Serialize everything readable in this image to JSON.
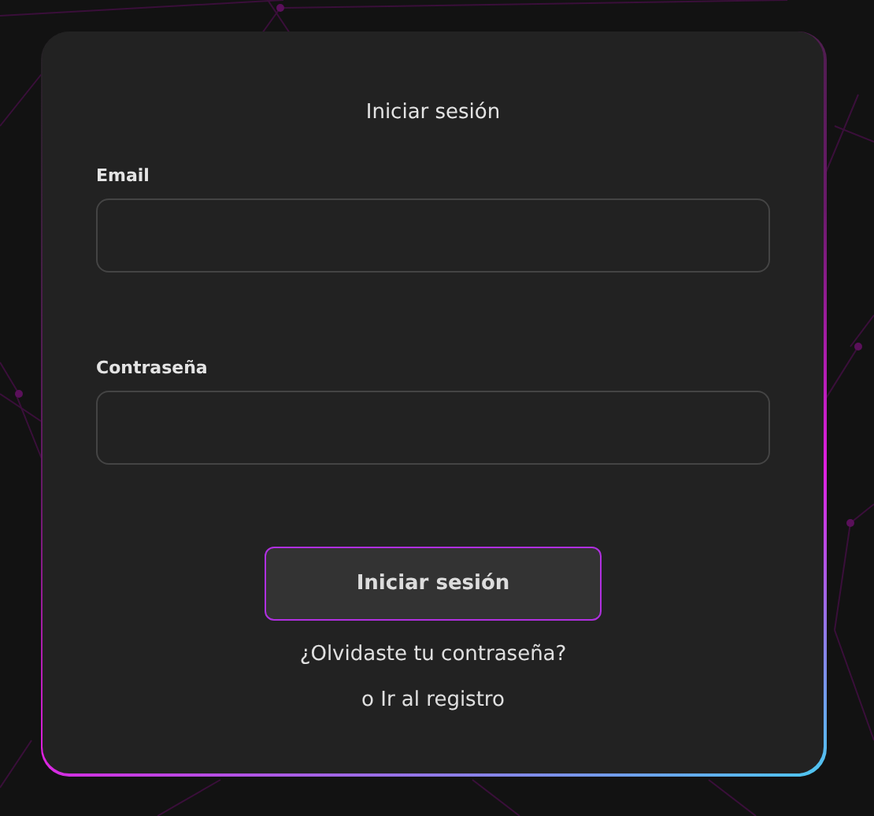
{
  "title": "Iniciar sesión",
  "fields": [
    {
      "label": "Email"
    },
    {
      "label": "Contraseña"
    }
  ],
  "submit": "Iniciar sesión",
  "links": [
    "¿Olvidaste tu contraseña?",
    "o Ir al registro"
  ]
}
